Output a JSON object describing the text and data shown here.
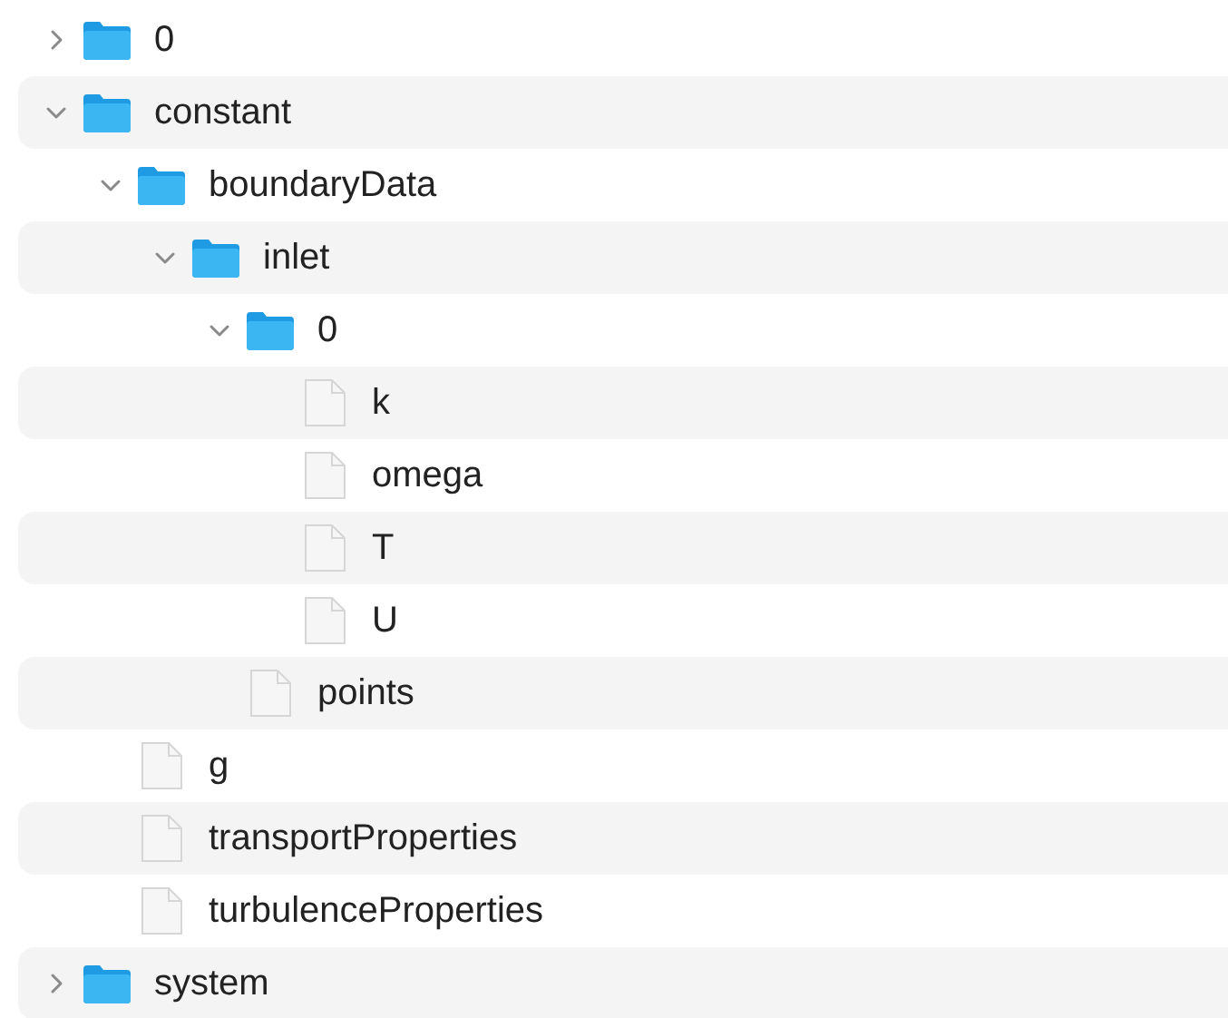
{
  "tree": [
    {
      "kind": "folder",
      "name": "0",
      "expanded": false
    },
    {
      "kind": "folder",
      "name": "constant",
      "expanded": true,
      "children": [
        {
          "kind": "folder",
          "name": "boundaryData",
          "expanded": true,
          "children": [
            {
              "kind": "folder",
              "name": "inlet",
              "expanded": true,
              "children": [
                {
                  "kind": "folder",
                  "name": "0",
                  "expanded": true,
                  "children": [
                    {
                      "kind": "file",
                      "name": "k"
                    },
                    {
                      "kind": "file",
                      "name": "omega"
                    },
                    {
                      "kind": "file",
                      "name": "T"
                    },
                    {
                      "kind": "file",
                      "name": "U"
                    }
                  ]
                },
                {
                  "kind": "file",
                  "name": "points"
                }
              ]
            }
          ]
        },
        {
          "kind": "file",
          "name": "g"
        },
        {
          "kind": "file",
          "name": "transportProperties"
        },
        {
          "kind": "file",
          "name": "turbulenceProperties"
        }
      ]
    },
    {
      "kind": "folder",
      "name": "system",
      "expanded": false
    }
  ]
}
